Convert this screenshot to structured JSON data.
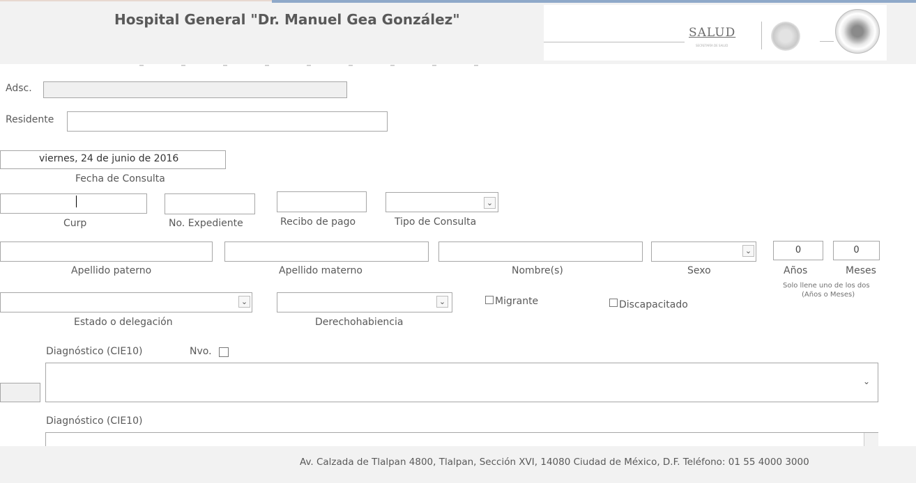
{
  "header": {
    "title": "Hospital General \"Dr. Manuel Gea González\"",
    "salud_logo": "SALUD",
    "salud_subtext": "SECRETARÍA DE SALUD",
    "seal_icon": "mexico-seal-icon",
    "hospital_seal_icon": "hospital-seal-icon"
  },
  "form": {
    "adsc_label": "Adsc.",
    "residente_label": "Residente",
    "fecha_value": "viernes, 24 de junio de 2016",
    "fecha_label": "Fecha de Consulta",
    "curp_label": "Curp",
    "expediente_label": "No. Expediente",
    "recibo_label": "Recibo de pago",
    "tipo_consulta_label": "Tipo de Consulta",
    "apellido_paterno_label": "Apellido paterno",
    "apellido_materno_label": "Apellido materno",
    "nombres_label": "Nombre(s)",
    "sexo_label": "Sexo",
    "anos_value": "0",
    "meses_value": "0",
    "anos_label": "Años",
    "meses_label": "Meses",
    "age_hint_line1": "Solo llene uno de los dos",
    "age_hint_line2": "(Años o Meses)",
    "estado_label": "Estado o delegación",
    "derecho_label": "Derechohabiencia",
    "migrante_label": "Migrante",
    "discapacitado_label": "Discapacitado",
    "diagnostico1_label": "Diagnóstico (CIE10)",
    "nvo_label": "Nvo.",
    "diagnostico2_label": "Diagnóstico (CIE10)"
  },
  "footer": {
    "address": "Av. Calzada de Tlalpan 4800, Tlalpan, Sección XVI, 14080 Ciudad de México, D.F. Teléfono: 01 55 4000 3000"
  },
  "colors": {
    "header_bg": "#f2f2f2",
    "footer_bg": "#f2f2f2",
    "accent_line": "#8fa9c9",
    "label_text": "#595959",
    "field_border": "#a6a6a6"
  }
}
